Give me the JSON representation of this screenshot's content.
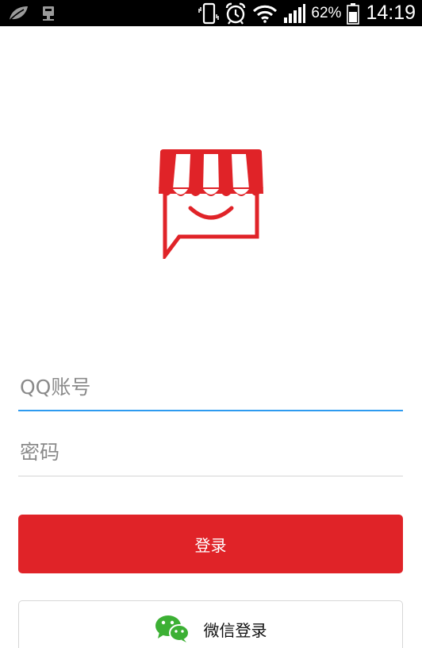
{
  "status_bar": {
    "battery_percent": "62%",
    "time": "14:19",
    "icons": [
      "leaf-notification-icon",
      "app-notification-icon",
      "vibrate-icon",
      "alarm-icon",
      "wifi-icon",
      "signal-icon",
      "battery-icon"
    ]
  },
  "login": {
    "account_placeholder": "QQ账号",
    "password_placeholder": "密码",
    "login_label": "登录",
    "wechat_label": "微信登录"
  },
  "colors": {
    "brand_red": "#e02328",
    "focus_blue": "#2e9bf0",
    "wechat_green": "#3cb034"
  }
}
